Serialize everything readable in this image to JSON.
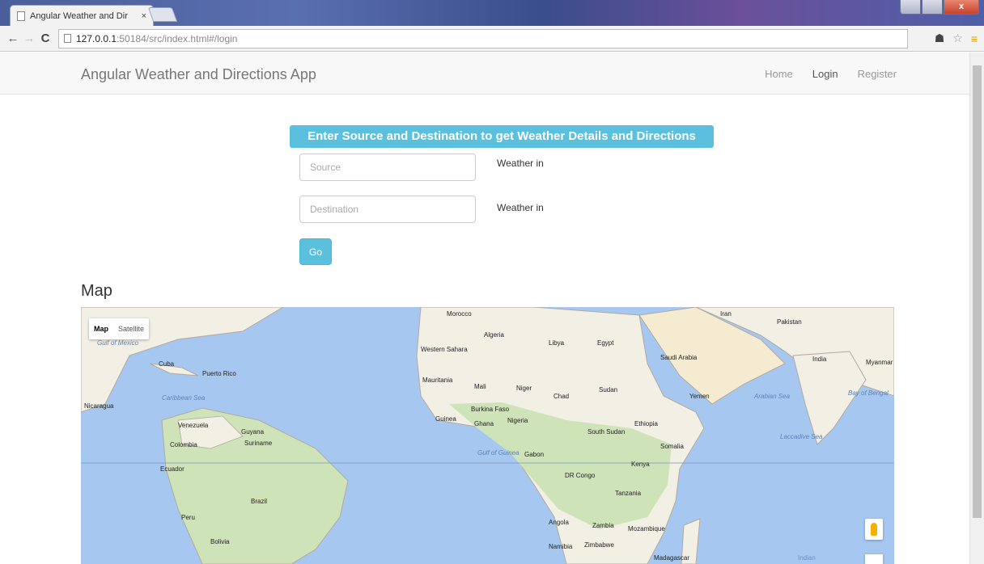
{
  "browser": {
    "tab_title": "Angular Weather and Dir",
    "tab_close": "×",
    "url_host": "127.0.0.1",
    "url_path": ":50184/src/index.html#/login",
    "back": "←",
    "forward": "→",
    "reload": "C",
    "ext_icon": "☗",
    "star_icon": "☆",
    "menu_icon": "≡",
    "close_glyph": "x"
  },
  "navbar": {
    "brand": "Angular Weather and Directions App",
    "links": [
      "Home",
      "Login",
      "Register"
    ]
  },
  "form": {
    "heading": "Enter Source and Destination to get Weather Details and Directions",
    "source_placeholder": "Source",
    "destination_placeholder": "Destination",
    "weather_label_1": "Weather in",
    "weather_label_2": "Weather in",
    "go_label": "Go"
  },
  "map": {
    "title": "Map",
    "type_options": [
      "Map",
      "Satellite"
    ],
    "selected_type": "Map",
    "labels": [
      "Morocco",
      "Algeria",
      "Libya",
      "Egypt",
      "Western Sahara",
      "Mauritania",
      "Mali",
      "Niger",
      "Chad",
      "Sudan",
      "Saudi Arabia",
      "Yemen",
      "Iran",
      "Pakistan",
      "India",
      "Myanmar (Burma)",
      "Burkina Faso",
      "Nigeria",
      "Guinea",
      "Ghana",
      "South Sudan",
      "Ethiopia",
      "Somalia",
      "Kenya",
      "DR Congo",
      "Tanzania",
      "Angola",
      "Zambia",
      "Mozambique",
      "Namibia",
      "Zimbabwe",
      "Madagascar",
      "Gabon",
      "Cuba",
      "Puerto Rico",
      "Venezuela",
      "Guyana",
      "Suriname",
      "Colombia",
      "Ecuador",
      "Peru",
      "Brazil",
      "Bolivia",
      "Nicaragua",
      "Gulf of Mexico",
      "Caribbean Sea",
      "Gulf of Guinea",
      "Arabian Sea",
      "Bay of Bengal",
      "Laccadive Sea",
      "Indian"
    ],
    "colors": {
      "water": "#a6c8f0",
      "land": "#f2efe5",
      "green": "#cfe3b8",
      "desert": "#f5ebd0",
      "border": "#b4a8a0",
      "heading": "#5bc0de"
    }
  }
}
